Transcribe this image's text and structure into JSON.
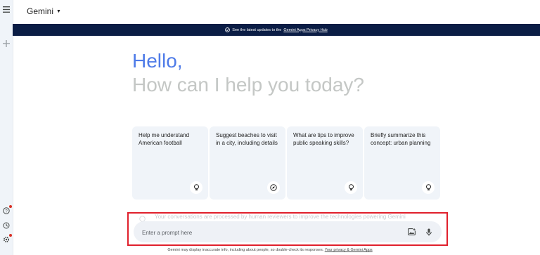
{
  "app": {
    "name": "Gemini"
  },
  "banner": {
    "text": "See the latest updates to the",
    "link": "Gemini Apps Privacy Hub"
  },
  "greeting": {
    "hello": "Hello,",
    "subtitle": "How can I help you today?"
  },
  "cards": [
    {
      "text": "Help me understand American football",
      "icon": "lightbulb-icon"
    },
    {
      "text": "Suggest beaches to visit in a city, including details",
      "icon": "compass-icon"
    },
    {
      "text": "What are tips to improve public speaking skills?",
      "icon": "lightbulb-icon"
    },
    {
      "text": "Briefly summarize this concept: urban planning",
      "icon": "lightbulb-icon"
    }
  ],
  "notice": "Your conversations are processed by human reviewers to improve the technologies powering Gemini",
  "prompt": {
    "placeholder": "Enter a prompt here"
  },
  "footer": {
    "text": "Gemini may display inaccurate info, including about people, so double-check its responses.",
    "link": "Your privacy & Gemini Apps"
  },
  "colors": {
    "banner": "#0b1d45",
    "hello": "#4e7be8",
    "card": "#f0f4f9",
    "highlight": "#e0202c"
  }
}
